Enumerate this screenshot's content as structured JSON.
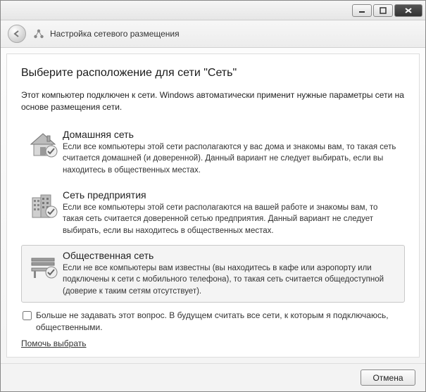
{
  "header": {
    "title": "Настройка сетевого размещения"
  },
  "main": {
    "heading": "Выберите расположение для сети \"Сеть\"",
    "intro": "Этот компьютер подключен к сети. Windows автоматически применит нужные параметры сети на основе размещения сети."
  },
  "options": {
    "home": {
      "title": "Домашняя сеть",
      "desc": "Если все компьютеры этой сети располагаются у вас дома и знакомы вам, то такая сеть считается домашней (и доверенной). Данный вариант не следует выбирать, если вы находитесь в общественных местах."
    },
    "work": {
      "title": "Сеть предприятия",
      "desc": "Если все компьютеры этой сети располагаются на вашей работе и знакомы вам, то такая сеть считается доверенной сетью предприятия. Данный вариант не следует выбирать, если вы находитесь в общественных местах."
    },
    "public": {
      "title": "Общественная сеть",
      "desc": "Если не все компьютеры вам известны (вы находитесь в кафе или аэропорту или подключены к сети с мобильного телефона), то такая сеть считается общедоступной (доверие к таким сетям отсутствует)."
    }
  },
  "checkbox": {
    "label": "Больше не задавать этот вопрос. В будущем считать все сети, к которым я подключаюсь, общественными."
  },
  "help": {
    "label": "Помочь выбрать"
  },
  "footer": {
    "cancel": "Отмена"
  }
}
